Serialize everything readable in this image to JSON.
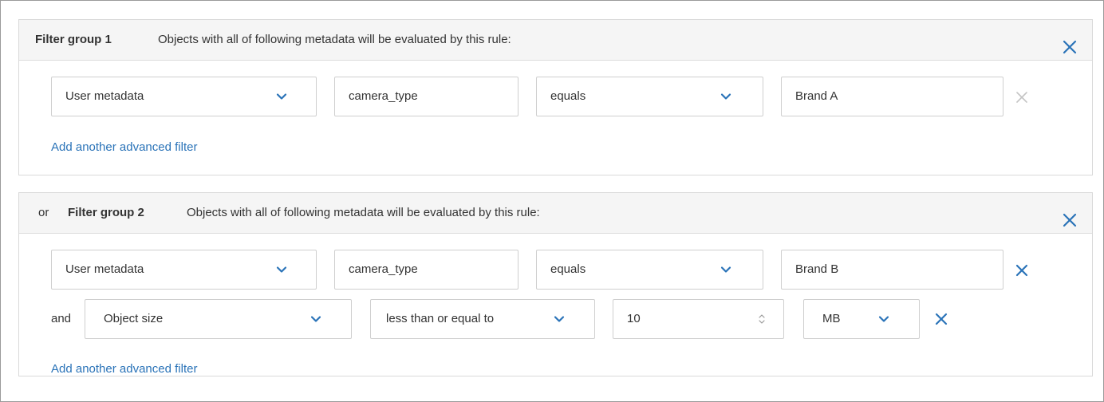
{
  "groups": [
    {
      "prefix": "",
      "title": "Filter group 1",
      "description": "Objects with all of following metadata will be evaluated by this rule:",
      "filters": [
        {
          "joiner": "",
          "type": "User metadata",
          "key": "camera_type",
          "operator": "equals",
          "value": "Brand A",
          "remove_icon": "close-icon-disabled"
        }
      ],
      "add_filter_label": "Add another advanced filter"
    },
    {
      "prefix": "or",
      "title": "Filter group 2",
      "description": "Objects with all of following metadata will be evaluated by this rule:",
      "filters": [
        {
          "joiner": "",
          "type": "User metadata",
          "key": "camera_type",
          "operator": "equals",
          "value": "Brand B",
          "remove_icon": "close-icon"
        },
        {
          "joiner": "and",
          "type": "Object size",
          "operator": "less than or equal to",
          "value": "10",
          "unit": "MB",
          "remove_icon": "close-icon"
        }
      ],
      "add_filter_label": "Add another advanced filter"
    }
  ],
  "colors": {
    "accent": "#2a73b8",
    "disabled_icon": "#c4c4c4",
    "header_bg": "#f5f5f5",
    "border": "#cfcfcf"
  }
}
